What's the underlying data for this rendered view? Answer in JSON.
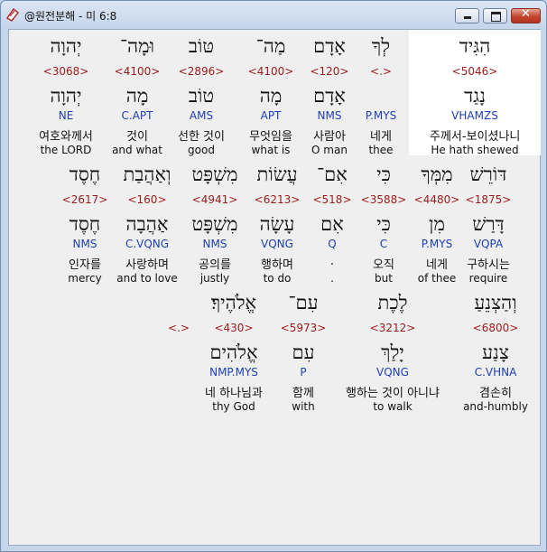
{
  "window": {
    "title": "@원전분해 - 미 6:8",
    "icon": "app-book-icon",
    "buttons": {
      "minimize": "minimize",
      "maximize": "maximize",
      "close": "close",
      "close_glyph": "✕"
    }
  },
  "rows": [
    [
      {
        "heb": "הִגִּיד",
        "num": "<5046>",
        "lemma": "נָגַד",
        "parse": "VHAMZS",
        "kor": "주께서-보이셨나니",
        "eng": "He hath shewed"
      },
      {
        "heb": "לְךָ",
        "num": "<.>",
        "lemma": "",
        "parse": "P.MYS",
        "kor": "네게",
        "eng": "thee"
      },
      {
        "heb": "אָדָם",
        "num": "<120>",
        "lemma": "אָדָם",
        "parse": "NMS",
        "kor": "사람아",
        "eng": "O man"
      },
      {
        "heb": "מַה־",
        "num": "<4100>",
        "lemma": "מָה",
        "parse": "APT",
        "kor": "무엇임을",
        "eng": "what is"
      },
      {
        "heb": "טּוֹב",
        "num": "<2896>",
        "lemma": "טוֹב",
        "parse": "AMS",
        "kor": "선한 것이",
        "eng": "good"
      },
      {
        "heb": "וּמָה־",
        "num": "<4100>",
        "lemma": "מָה",
        "parse": "C.APT",
        "kor": "것이",
        "eng": "and what"
      },
      {
        "heb": "יְהוָה",
        "num": "<3068>",
        "lemma": "יְהוָה",
        "parse": "NE",
        "kor": "여호와께서",
        "eng": "the LORD"
      }
    ],
    [
      {
        "heb": "דּוֹרֵשׁ",
        "num": "<1875>",
        "lemma": "דָּרַשׁ",
        "parse": "VQPA",
        "kor": "구하시는",
        "eng": "require"
      },
      {
        "heb": "מִמְּךָ",
        "num": "<4480>",
        "lemma": "מִן",
        "parse": "P.MYS",
        "kor": "네게",
        "eng": "of thee"
      },
      {
        "heb": "כִּי",
        "num": "<3588>",
        "lemma": "כִּי",
        "parse": "C",
        "kor": "오직",
        "eng": "but"
      },
      {
        "heb": "אִם־",
        "num": "<518>",
        "lemma": "אִם",
        "parse": "Q",
        "kor": ".",
        "eng": "."
      },
      {
        "heb": "עֲשׂוֹת",
        "num": "<6213>",
        "lemma": "עָשָׂה",
        "parse": "VQNG",
        "kor": "행하며",
        "eng": "to do"
      },
      {
        "heb": "מִשְׁפָּט",
        "num": "<4941>",
        "lemma": "מִשְׁפָּט",
        "parse": "NMS",
        "kor": "공의를",
        "eng": "justly"
      },
      {
        "heb": "וְאַהֲבַת",
        "num": "<160>",
        "lemma": "אַהֲבָה",
        "parse": "C.VQNG",
        "kor": "사랑하며",
        "eng": "and to love"
      },
      {
        "heb": "חֶסֶד",
        "num": "<2617>",
        "lemma": "חֶסֶד",
        "parse": "NMS",
        "kor": "인자를",
        "eng": "mercy"
      }
    ],
    [
      {
        "heb": "וְהַצְנֵעַ",
        "num": "<6800>",
        "lemma": "צָנַע",
        "parse": "C.VHNA",
        "kor": "겸손히",
        "eng": "and-humbly"
      },
      {
        "heb": "לֶכֶת",
        "num": "<3212>",
        "lemma": "יָלַךְ",
        "parse": "VQNG",
        "kor": "행하는 것이 아니냐",
        "eng": "to walk"
      },
      {
        "heb": "עִם־",
        "num": "<5973>",
        "lemma": "עִם",
        "parse": "P",
        "kor": "함께",
        "eng": "with"
      },
      {
        "heb": "אֱלֹהֶיךָ׃",
        "num": "<430>",
        "lemma": "אֱלֹהִים",
        "parse": "NMP.MYS",
        "kor": "네 하나님과",
        "eng": "thy God"
      },
      {
        "heb": "",
        "num": "<.>",
        "lemma": "",
        "parse": "",
        "kor": "",
        "eng": ""
      }
    ]
  ]
}
